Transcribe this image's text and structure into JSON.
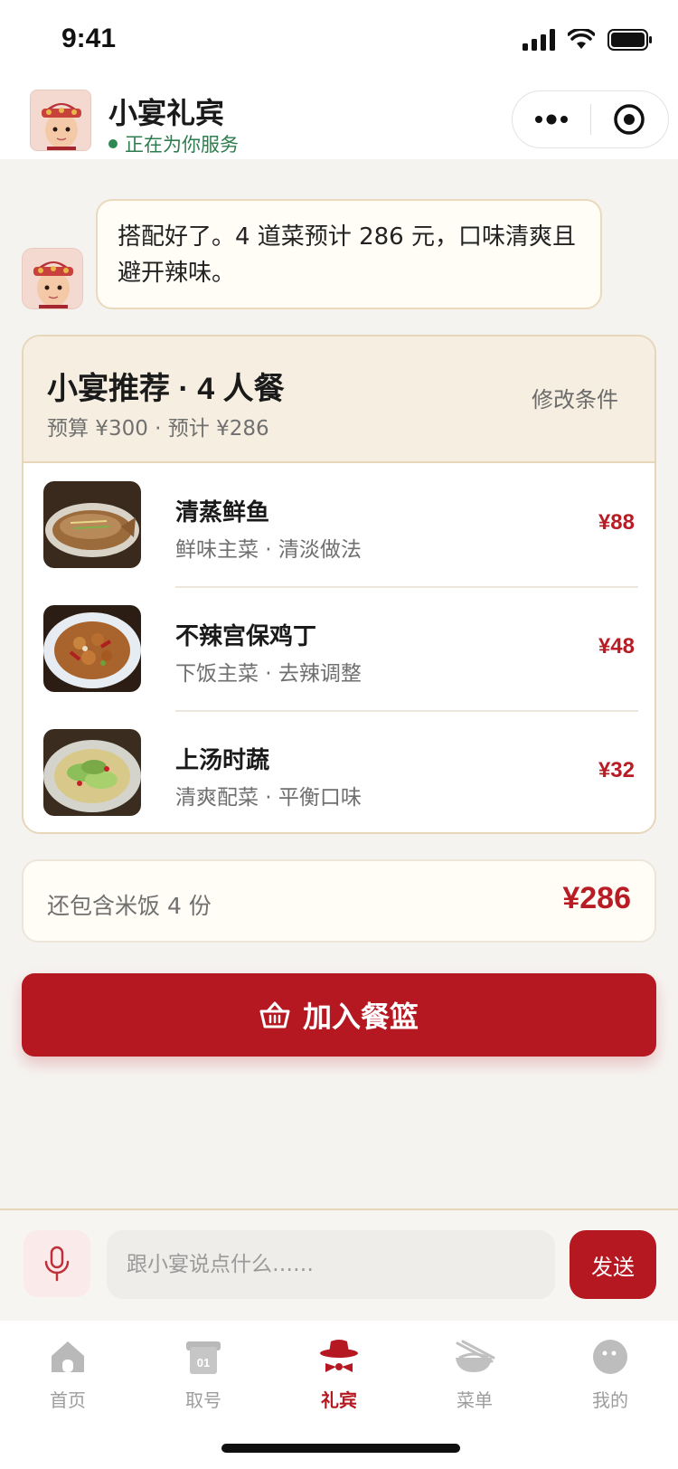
{
  "status_bar": {
    "time": "9:41"
  },
  "header": {
    "title": "小宴礼宾",
    "status": "正在为你服务"
  },
  "chat": {
    "message": "搭配好了。4 道菜预计 286 元，口味清爽且避开辣味。"
  },
  "recommendation": {
    "title": "小宴推荐 · 4 人餐",
    "subtitle": "预算 ¥300 · 预计 ¥286",
    "edit_label": "修改条件",
    "dishes": [
      {
        "name": "清蒸鲜鱼",
        "desc": "鲜味主菜 · 清淡做法",
        "price": "¥88"
      },
      {
        "name": "不辣宫保鸡丁",
        "desc": "下饭主菜 · 去辣调整",
        "price": "¥48"
      },
      {
        "name": "上汤时蔬",
        "desc": "清爽配菜 · 平衡口味",
        "price": "¥32"
      }
    ]
  },
  "summary": {
    "text": "还包含米饭 4 份",
    "total": "¥286"
  },
  "add_button": {
    "label": "加入餐篮"
  },
  "input": {
    "placeholder": "跟小宴说点什么……",
    "send_label": "发送"
  },
  "tabs": [
    {
      "label": "首页",
      "icon": "home-icon"
    },
    {
      "label": "取号",
      "icon": "ticket-icon"
    },
    {
      "label": "礼宾",
      "icon": "concierge-icon",
      "active": true
    },
    {
      "label": "菜单",
      "icon": "bowl-icon"
    },
    {
      "label": "我的",
      "icon": "profile-icon"
    }
  ],
  "colors": {
    "accent": "#b61822",
    "price": "#b81c25",
    "online": "#2f8a52",
    "card_header": "#f6efe1"
  }
}
